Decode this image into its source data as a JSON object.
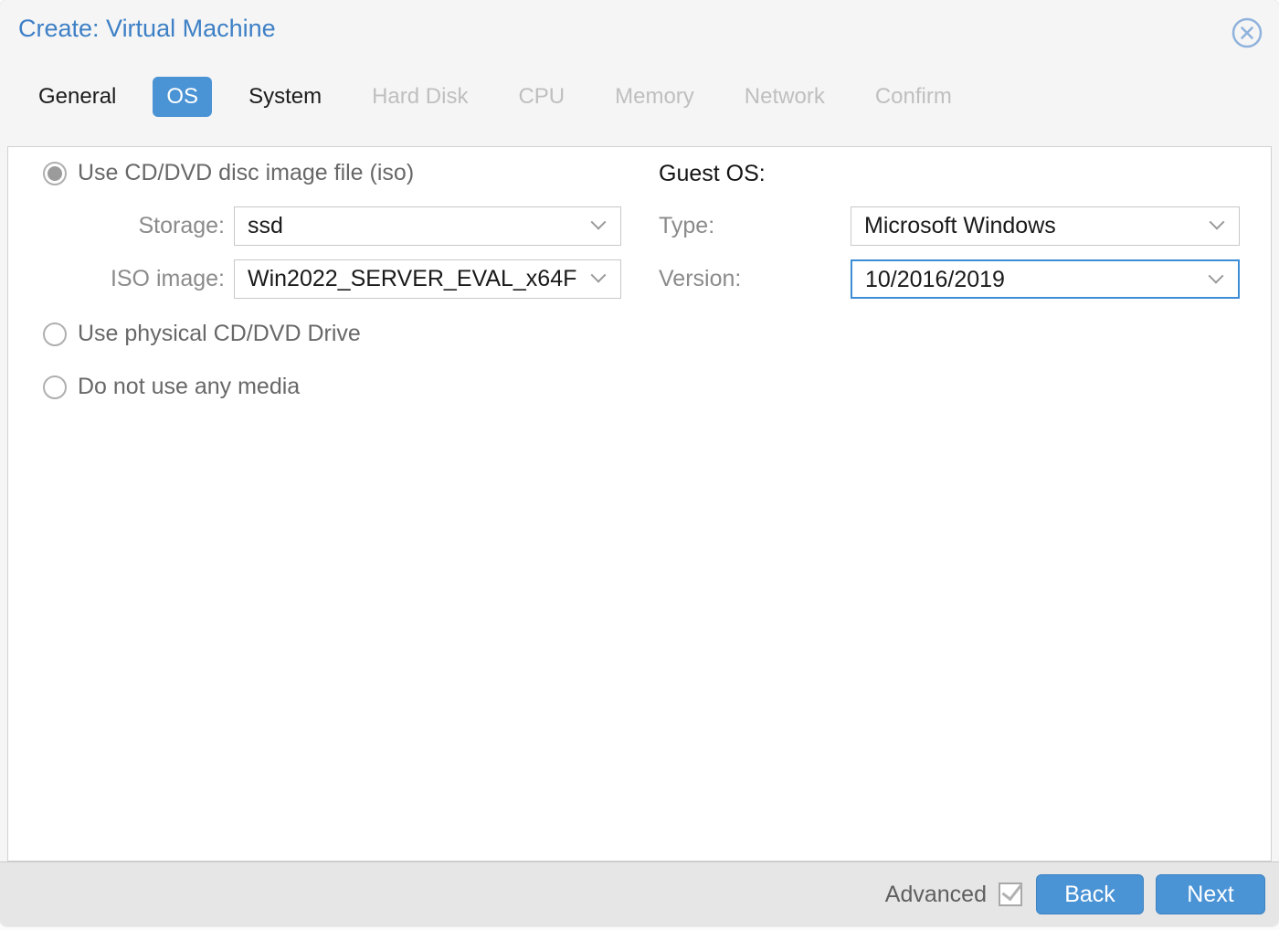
{
  "dialog": {
    "title": "Create: Virtual Machine"
  },
  "tabs": [
    {
      "label": "General",
      "state": "enabled"
    },
    {
      "label": "OS",
      "state": "active"
    },
    {
      "label": "System",
      "state": "enabled"
    },
    {
      "label": "Hard Disk",
      "state": "disabled"
    },
    {
      "label": "CPU",
      "state": "disabled"
    },
    {
      "label": "Memory",
      "state": "disabled"
    },
    {
      "label": "Network",
      "state": "disabled"
    },
    {
      "label": "Confirm",
      "state": "disabled"
    }
  ],
  "media": {
    "options": [
      {
        "label": "Use CD/DVD disc image file (iso)",
        "selected": true
      },
      {
        "label": "Use physical CD/DVD Drive",
        "selected": false
      },
      {
        "label": "Do not use any media",
        "selected": false
      }
    ],
    "storage": {
      "label": "Storage:",
      "value": "ssd"
    },
    "iso_image": {
      "label": "ISO image:",
      "value": "Win2022_SERVER_EVAL_x64F"
    }
  },
  "guest_os": {
    "heading": "Guest OS:",
    "type": {
      "label": "Type:",
      "value": "Microsoft Windows"
    },
    "version": {
      "label": "Version:",
      "value": "10/2016/2019",
      "focused": true
    }
  },
  "footer": {
    "advanced_label": "Advanced",
    "advanced_checked": true,
    "back_label": "Back",
    "next_label": "Next"
  },
  "colors": {
    "accent_blue": "#4a93d5",
    "title_blue": "#3e80c6",
    "focus_border": "#3c8cd6",
    "disabled_tab": "#bfbfbf",
    "footer_bg": "#e6e6e6"
  }
}
